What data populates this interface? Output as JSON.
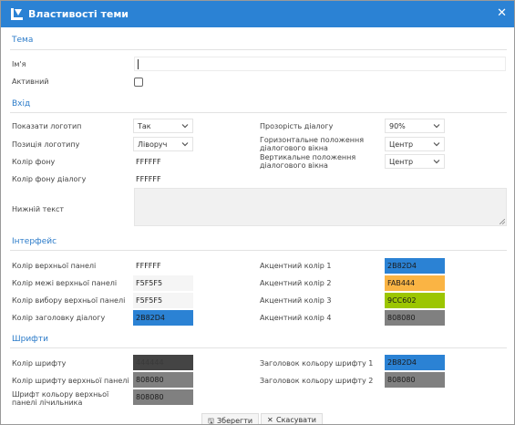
{
  "window": {
    "title": "Властивості теми",
    "close_icon": "close-icon",
    "logo_icon": "app-logo-icon"
  },
  "theme": {
    "section": "Тема",
    "name_label": "Ім'я",
    "name_value": "",
    "active_label": "Активний",
    "active_checked": false
  },
  "login": {
    "section": "Вхід",
    "show_logo_label": "Показати логотип",
    "show_logo_value": "Так",
    "logo_pos_label": "Позиція логотипу",
    "logo_pos_value": "Ліворуч",
    "bg_color_label": "Колір фону",
    "bg_color_value": "FFFFFF",
    "dialog_bg_label": "Колір фону діалогу",
    "dialog_bg_value": "FFFFFF",
    "footer_label": "Нижній текст",
    "footer_value": "",
    "opacity_label": "Прозорість діалогу",
    "opacity_value": "90%",
    "hpos_label": "Горизонтальне положення діалогового вікна",
    "hpos_value": "Центр",
    "vpos_label": "Вертикальне положення діалогового вікна",
    "vpos_value": "Центр"
  },
  "interface": {
    "section": "Інтерфейс",
    "left": [
      {
        "label": "Колір верхньої панелі",
        "value": "FFFFFF",
        "color": "#ffffff",
        "text_color": "#222222"
      },
      {
        "label": "Колір межі верхньої панелі",
        "value": "F5F5F5",
        "color": "#f5f5f5",
        "text_color": "#222222"
      },
      {
        "label": "Колір вибору верхньої панелі",
        "value": "F5F5F5",
        "color": "#f5f5f5",
        "text_color": "#222222"
      },
      {
        "label": "Колір заголовку діалогу",
        "value": "2B82D4",
        "color": "#2b82d4",
        "text_color": "#1a1a1a"
      }
    ],
    "right": [
      {
        "label": "Акцентний колір 1",
        "value": "2B82D4",
        "color": "#2b82d4",
        "text_color": "#1a1a1a"
      },
      {
        "label": "Акцентний колір 2",
        "value": "FAB444",
        "color": "#fab444",
        "text_color": "#1a1a1a"
      },
      {
        "label": "Акцентний колір 3",
        "value": "9CC602",
        "color": "#9cc602",
        "text_color": "#1a1a1a"
      },
      {
        "label": "Акцентний колір 4",
        "value": "808080",
        "color": "#808080",
        "text_color": "#1a1a1a"
      }
    ]
  },
  "fonts": {
    "section": "Шрифти",
    "left": [
      {
        "label": "Колір шрифту",
        "value": "444444",
        "color": "#444444",
        "text_color": "#3a3a3a"
      },
      {
        "label": "Колір шрифту верхньої панелі",
        "value": "808080",
        "color": "#808080",
        "text_color": "#1a1a1a"
      },
      {
        "label": "Шрифт кольору верхньої панелі лічильника",
        "value": "808080",
        "color": "#808080",
        "text_color": "#1a1a1a"
      }
    ],
    "right": [
      {
        "label": "Заголовок кольору шрифту 1",
        "value": "2B82D4",
        "color": "#2b82d4",
        "text_color": "#1a1a1a"
      },
      {
        "label": "Заголовок кольору шрифту 2",
        "value": "808080",
        "color": "#808080",
        "text_color": "#1a1a1a"
      }
    ]
  },
  "buttons": {
    "save": "Зберегти",
    "cancel": "Скасувати"
  },
  "colors": {
    "accent": "#2b82d4",
    "section_title": "#2b7bc9"
  }
}
